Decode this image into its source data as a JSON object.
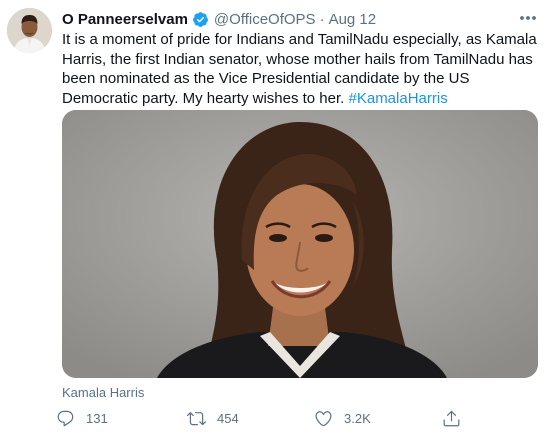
{
  "tweet": {
    "author_name": "O Panneerselvam",
    "handle": "@OfficeOfOPS",
    "separator": "·",
    "date": "Aug 12",
    "text": "It is a moment of pride for Indians and TamilNadu especially, as Kamala Harris, the first Indian senator, whose mother hails from TamilNadu has been nominated as the Vice Presidential candidate by the US Democratic party. My hearty wishes to her. ",
    "hashtag": "#KamalaHarris",
    "media_caption": "Kamala Harris",
    "replies": "131",
    "retweets": "454",
    "likes": "3.2K"
  },
  "icons": {
    "verified": "verified-badge-icon",
    "more": "more-options-icon",
    "reply": "reply-icon",
    "retweet": "retweet-icon",
    "like": "heart-icon",
    "share": "share-icon"
  },
  "colors": {
    "text": "#0f1419",
    "secondary": "#5b7083",
    "link": "#1b95e0",
    "verified": "#1da1f2"
  }
}
